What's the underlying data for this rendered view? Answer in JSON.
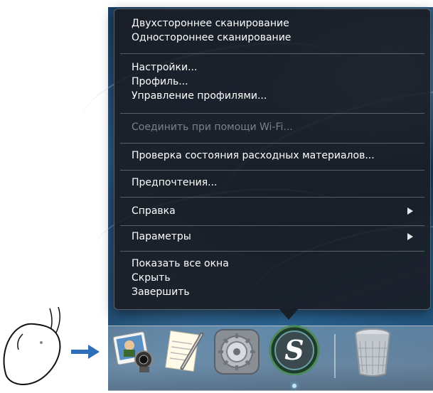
{
  "menu": {
    "group1": [
      "Двухстороннее сканирование",
      "Одностороннее сканирование"
    ],
    "group2": [
      "Настройки...",
      "Профиль...",
      "Управление профилями..."
    ],
    "wifi_disabled": "Соединить при помощи Wi-Fi...",
    "consumables": "Проверка состояния расходных материалов...",
    "preferences": "Предпочтения...",
    "help": "Справка",
    "options": "Параметры",
    "group_last": [
      "Показать все окна",
      "Скрыть",
      "Завершить"
    ]
  },
  "dock": {
    "icons": [
      "photo-viewer-icon",
      "text-editor-icon",
      "system-preferences-icon",
      "scansnap-manager-icon",
      "trash-icon"
    ],
    "accent_color": "#2f6fb8"
  }
}
